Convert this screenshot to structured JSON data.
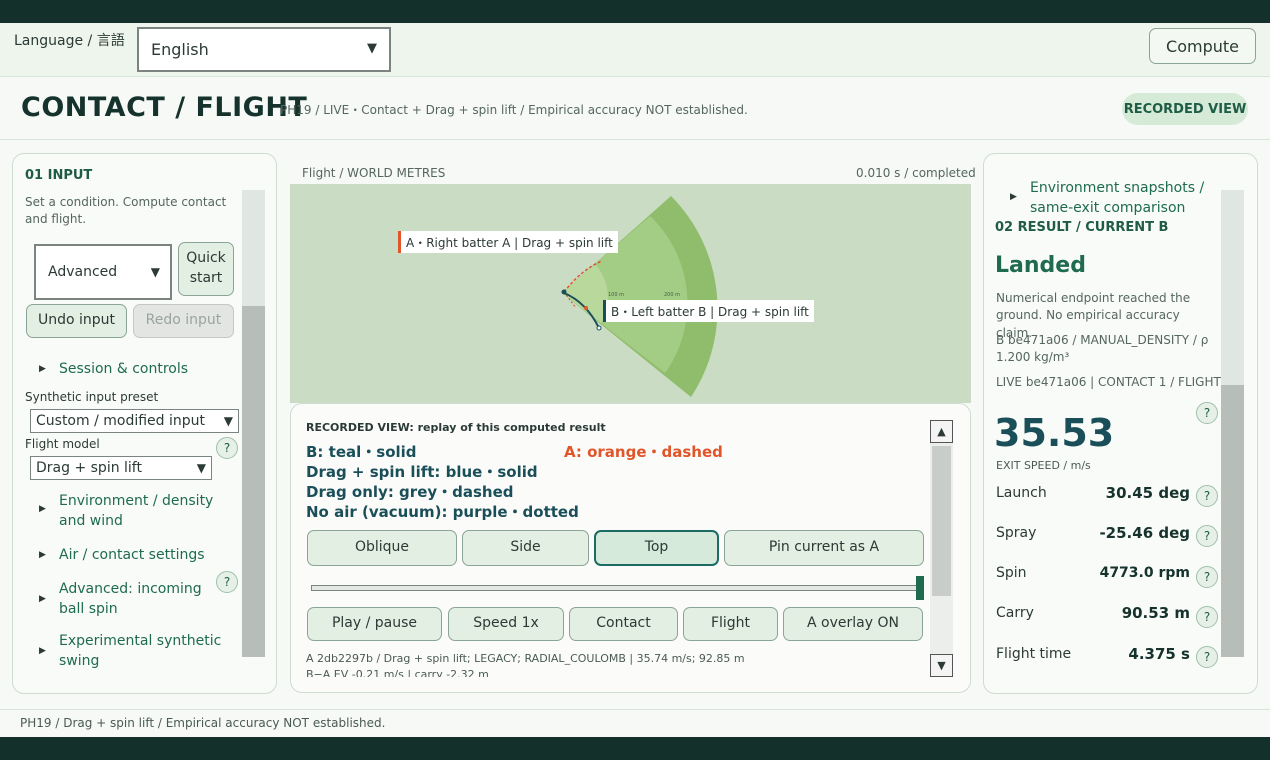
{
  "header": {
    "language_label": "Language / 言語",
    "language_value": "English",
    "compute_label": "Compute",
    "page_title": "CONTACT / FLIGHT",
    "page_subtitle": "PH19 / LIVE・Contact + Drag + spin lift / Empirical accuracy NOT established.",
    "badge": "RECORDED VIEW"
  },
  "left": {
    "section": "01  INPUT",
    "desc": "Set a condition. Compute contact and flight.",
    "mode_value": "Advanced",
    "quick_start": "Quick start",
    "undo": "Undo input",
    "redo": "Redo input",
    "session": "Session & controls",
    "preset_label": "Synthetic input preset",
    "preset_value": "Custom / modified input",
    "model_label": "Flight model",
    "model_value": "Drag + spin lift",
    "env": "Environment / density and wind",
    "air": "Air / contact settings",
    "adv": "Advanced: incoming ball spin",
    "exp": "Experimental synthetic swing"
  },
  "middle": {
    "map_title": "Flight / WORLD METRES",
    "map_status": "0.010 s / completed",
    "label_a": "A・Right batter A | Drag + spin lift",
    "label_b": "B・Left batter B | Drag + spin lift",
    "ring_100": "100 m",
    "ring_200": "200 m",
    "recorded_note": "RECORDED VIEW: replay of this computed result",
    "legend_b": "B: teal・solid",
    "legend_a": "A: orange・dashed",
    "legend_blue": "Drag + spin lift: blue・solid",
    "legend_grey": "Drag only: grey・dashed",
    "legend_purple": "No air (vacuum): purple・dotted",
    "view_oblique": "Oblique",
    "view_side": "Side",
    "view_top": "Top",
    "pin": "Pin current as A",
    "play": "Play / pause",
    "speed": "Speed 1x",
    "contact": "Contact",
    "flight": "Flight",
    "overlay": "A overlay ON",
    "info1": "A 2db2297b / Drag + spin lift; LEGACY; RADIAL_COULOMB | 35.74 m/s; 92.85 m",
    "info2": "B−A EV -0.21 m/s | carry -2.32 m"
  },
  "right": {
    "env_link": "Environment snapshots / same-exit comparison",
    "section": "02  RESULT / CURRENT B",
    "status": "Landed",
    "status_desc": "Numerical endpoint reached the ground. No empirical accuracy claim.",
    "meta1": "B be471a06 / MANUAL_DENSITY / ρ 1.200 kg/m³",
    "meta2": "LIVE be471a06 | CONTACT 1 / FLIGHT 3",
    "exit_speed": "35.53",
    "exit_label": "EXIT SPEED / m/s",
    "rows": [
      {
        "label": "Launch",
        "value": "30.45 deg"
      },
      {
        "label": "Spray",
        "value": "-25.46 deg"
      },
      {
        "label": "Spin",
        "value": "4773.0 rpm"
      },
      {
        "label": "Carry",
        "value": "90.53 m"
      },
      {
        "label": "Flight time",
        "value": "4.375 s"
      }
    ]
  },
  "footer": {
    "text": "PH19 / Drag + spin lift / Empirical accuracy NOT established."
  },
  "colors": {
    "accent": "#1e6b4f",
    "trajectory_b": "#1a4f5a",
    "trajectory_a": "#e0552a",
    "field_dark": "#7fae5e",
    "field_light": "#a8cc88"
  }
}
